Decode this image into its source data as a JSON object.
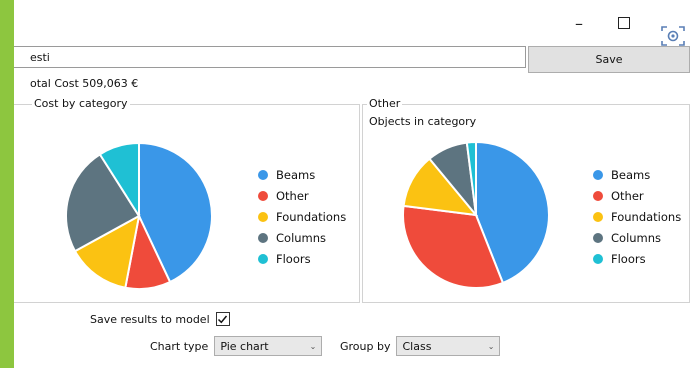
{
  "window": {
    "minimize_glyph": "–",
    "name_value": "esti",
    "save_label": "Save",
    "total_cost_text": "otal Cost 509,063 €"
  },
  "left_group": {
    "legend_text": "Cost by category"
  },
  "right_group": {
    "legend_text": "Other",
    "subtitle": "Objects in category"
  },
  "options": {
    "save_results_label": "Save results to model",
    "save_results_checked": true,
    "chart_type_label": "Chart type",
    "chart_type_value": "Pie chart",
    "group_by_label": "Group by",
    "group_by_value": "Class"
  },
  "colors": {
    "Beams": "#3a97e8",
    "Other": "#ef4b3b",
    "Foundations": "#fbc212",
    "Columns": "#5d7480",
    "Floors": "#1fc0d4"
  },
  "chart_data": [
    {
      "type": "pie",
      "title": "",
      "legend_position": "right",
      "categories": [
        "Beams",
        "Other",
        "Foundations",
        "Columns",
        "Floors"
      ],
      "values": [
        43,
        10,
        14,
        24,
        9
      ]
    },
    {
      "type": "pie",
      "title": "",
      "legend_position": "right",
      "categories": [
        "Beams",
        "Other",
        "Foundations",
        "Columns",
        "Floors"
      ],
      "values": [
        44,
        33,
        12,
        9,
        2
      ]
    }
  ]
}
